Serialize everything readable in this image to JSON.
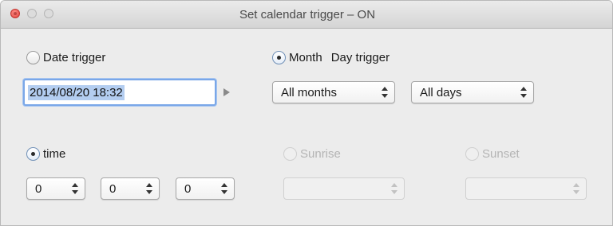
{
  "window": {
    "title": "Set calendar trigger – ON"
  },
  "date_trigger": {
    "label": "Date trigger",
    "selected": false,
    "value": "2014/08/20 18:32"
  },
  "month_day_trigger": {
    "month_label": "Month",
    "day_label": "Day trigger",
    "selected": true,
    "month_value": "All months",
    "day_value": "All days"
  },
  "time": {
    "label": "time",
    "selected": true,
    "fields": [
      "0",
      "0",
      "0"
    ]
  },
  "sunrise": {
    "label": "Sunrise",
    "selected": false,
    "enabled": false,
    "value": ""
  },
  "sunset": {
    "label": "Sunset",
    "selected": false,
    "enabled": false,
    "value": ""
  },
  "colors": {
    "window_bg": "#ececec",
    "focus_ring": "#7aa7e8",
    "selection": "#b3cdf0"
  }
}
